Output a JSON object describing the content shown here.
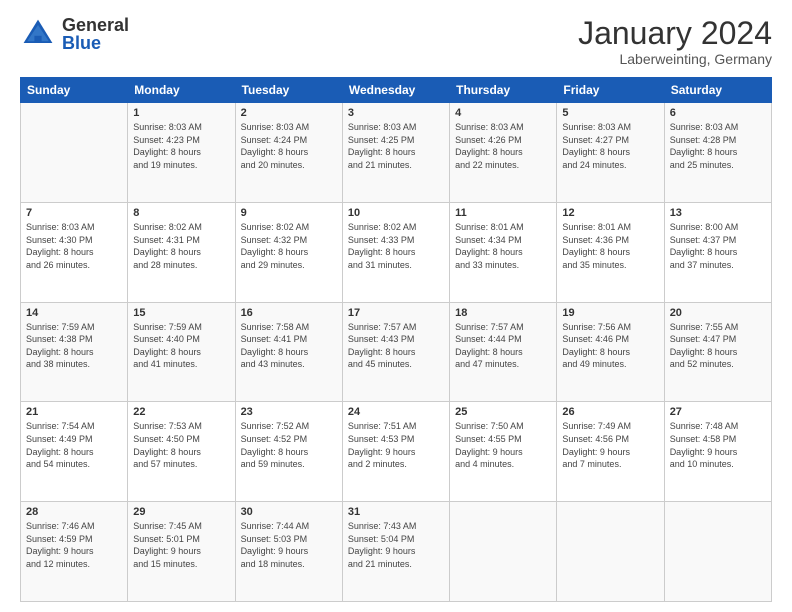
{
  "logo": {
    "general": "General",
    "blue": "Blue"
  },
  "header": {
    "month": "January 2024",
    "location": "Laberweinting, Germany"
  },
  "weekdays": [
    "Sunday",
    "Monday",
    "Tuesday",
    "Wednesday",
    "Thursday",
    "Friday",
    "Saturday"
  ],
  "weeks": [
    [
      {
        "day": "",
        "info": ""
      },
      {
        "day": "1",
        "info": "Sunrise: 8:03 AM\nSunset: 4:23 PM\nDaylight: 8 hours\nand 19 minutes."
      },
      {
        "day": "2",
        "info": "Sunrise: 8:03 AM\nSunset: 4:24 PM\nDaylight: 8 hours\nand 20 minutes."
      },
      {
        "day": "3",
        "info": "Sunrise: 8:03 AM\nSunset: 4:25 PM\nDaylight: 8 hours\nand 21 minutes."
      },
      {
        "day": "4",
        "info": "Sunrise: 8:03 AM\nSunset: 4:26 PM\nDaylight: 8 hours\nand 22 minutes."
      },
      {
        "day": "5",
        "info": "Sunrise: 8:03 AM\nSunset: 4:27 PM\nDaylight: 8 hours\nand 24 minutes."
      },
      {
        "day": "6",
        "info": "Sunrise: 8:03 AM\nSunset: 4:28 PM\nDaylight: 8 hours\nand 25 minutes."
      }
    ],
    [
      {
        "day": "7",
        "info": "Sunrise: 8:03 AM\nSunset: 4:30 PM\nDaylight: 8 hours\nand 26 minutes."
      },
      {
        "day": "8",
        "info": "Sunrise: 8:02 AM\nSunset: 4:31 PM\nDaylight: 8 hours\nand 28 minutes."
      },
      {
        "day": "9",
        "info": "Sunrise: 8:02 AM\nSunset: 4:32 PM\nDaylight: 8 hours\nand 29 minutes."
      },
      {
        "day": "10",
        "info": "Sunrise: 8:02 AM\nSunset: 4:33 PM\nDaylight: 8 hours\nand 31 minutes."
      },
      {
        "day": "11",
        "info": "Sunrise: 8:01 AM\nSunset: 4:34 PM\nDaylight: 8 hours\nand 33 minutes."
      },
      {
        "day": "12",
        "info": "Sunrise: 8:01 AM\nSunset: 4:36 PM\nDaylight: 8 hours\nand 35 minutes."
      },
      {
        "day": "13",
        "info": "Sunrise: 8:00 AM\nSunset: 4:37 PM\nDaylight: 8 hours\nand 37 minutes."
      }
    ],
    [
      {
        "day": "14",
        "info": "Sunrise: 7:59 AM\nSunset: 4:38 PM\nDaylight: 8 hours\nand 38 minutes."
      },
      {
        "day": "15",
        "info": "Sunrise: 7:59 AM\nSunset: 4:40 PM\nDaylight: 8 hours\nand 41 minutes."
      },
      {
        "day": "16",
        "info": "Sunrise: 7:58 AM\nSunset: 4:41 PM\nDaylight: 8 hours\nand 43 minutes."
      },
      {
        "day": "17",
        "info": "Sunrise: 7:57 AM\nSunset: 4:43 PM\nDaylight: 8 hours\nand 45 minutes."
      },
      {
        "day": "18",
        "info": "Sunrise: 7:57 AM\nSunset: 4:44 PM\nDaylight: 8 hours\nand 47 minutes."
      },
      {
        "day": "19",
        "info": "Sunrise: 7:56 AM\nSunset: 4:46 PM\nDaylight: 8 hours\nand 49 minutes."
      },
      {
        "day": "20",
        "info": "Sunrise: 7:55 AM\nSunset: 4:47 PM\nDaylight: 8 hours\nand 52 minutes."
      }
    ],
    [
      {
        "day": "21",
        "info": "Sunrise: 7:54 AM\nSunset: 4:49 PM\nDaylight: 8 hours\nand 54 minutes."
      },
      {
        "day": "22",
        "info": "Sunrise: 7:53 AM\nSunset: 4:50 PM\nDaylight: 8 hours\nand 57 minutes."
      },
      {
        "day": "23",
        "info": "Sunrise: 7:52 AM\nSunset: 4:52 PM\nDaylight: 8 hours\nand 59 minutes."
      },
      {
        "day": "24",
        "info": "Sunrise: 7:51 AM\nSunset: 4:53 PM\nDaylight: 9 hours\nand 2 minutes."
      },
      {
        "day": "25",
        "info": "Sunrise: 7:50 AM\nSunset: 4:55 PM\nDaylight: 9 hours\nand 4 minutes."
      },
      {
        "day": "26",
        "info": "Sunrise: 7:49 AM\nSunset: 4:56 PM\nDaylight: 9 hours\nand 7 minutes."
      },
      {
        "day": "27",
        "info": "Sunrise: 7:48 AM\nSunset: 4:58 PM\nDaylight: 9 hours\nand 10 minutes."
      }
    ],
    [
      {
        "day": "28",
        "info": "Sunrise: 7:46 AM\nSunset: 4:59 PM\nDaylight: 9 hours\nand 12 minutes."
      },
      {
        "day": "29",
        "info": "Sunrise: 7:45 AM\nSunset: 5:01 PM\nDaylight: 9 hours\nand 15 minutes."
      },
      {
        "day": "30",
        "info": "Sunrise: 7:44 AM\nSunset: 5:03 PM\nDaylight: 9 hours\nand 18 minutes."
      },
      {
        "day": "31",
        "info": "Sunrise: 7:43 AM\nSunset: 5:04 PM\nDaylight: 9 hours\nand 21 minutes."
      },
      {
        "day": "",
        "info": ""
      },
      {
        "day": "",
        "info": ""
      },
      {
        "day": "",
        "info": ""
      }
    ]
  ]
}
